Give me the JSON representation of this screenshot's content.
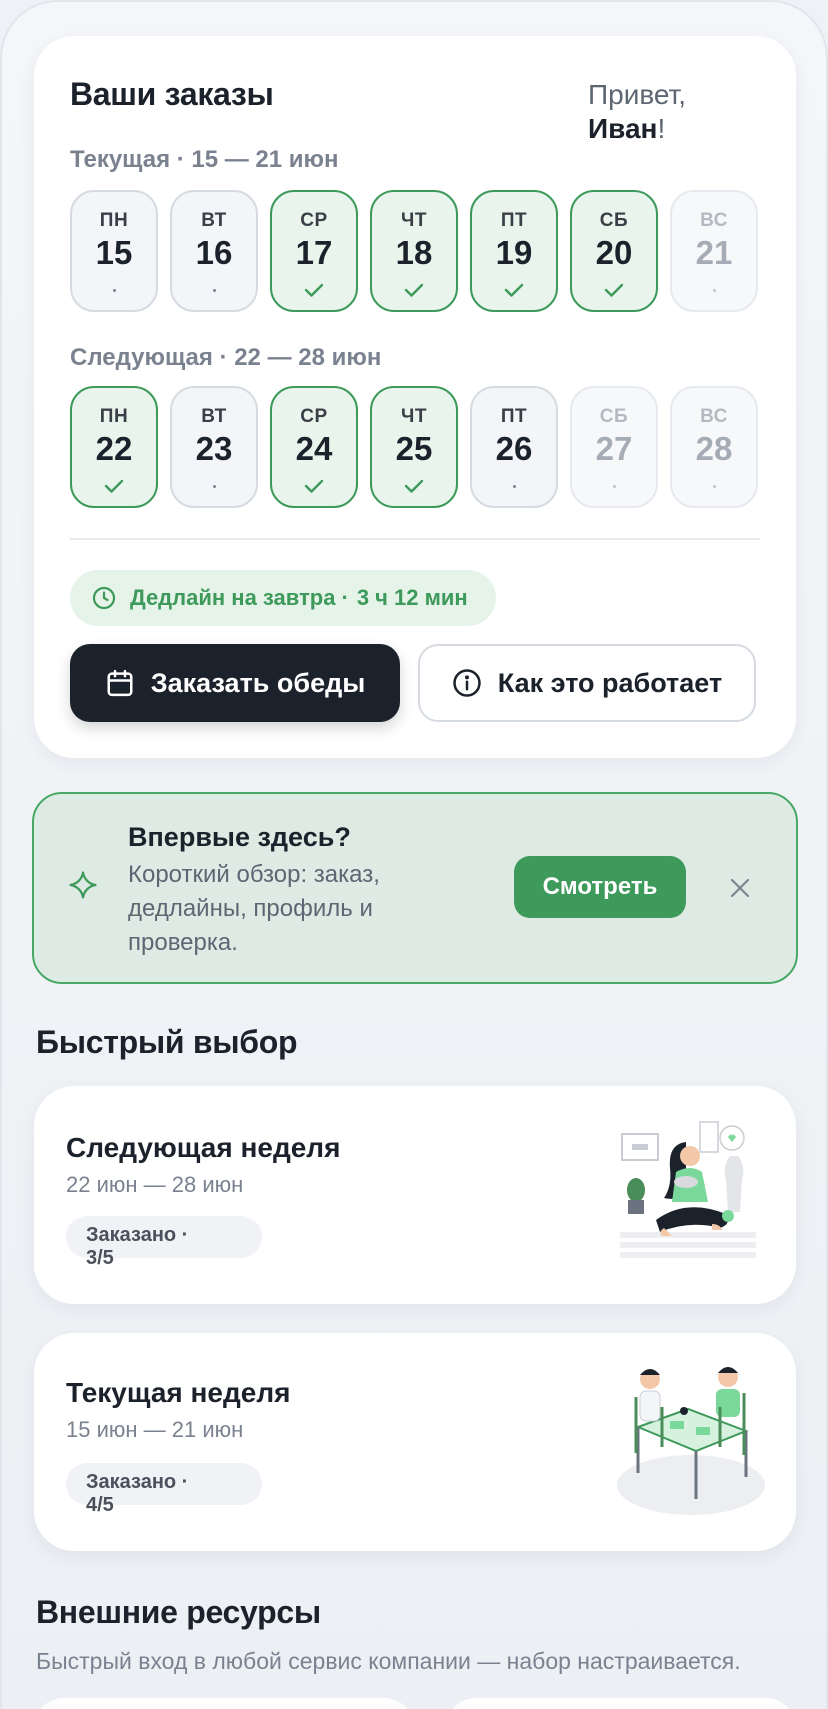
{
  "orders": {
    "title": "Ваши заказы",
    "greeting": "Привет,",
    "user_name": "Иван",
    "greeting_suffix": "!",
    "current_week": {
      "label": "Текущая · 15 — 21 июн",
      "days": [
        {
          "name": "ПН",
          "num": "15",
          "state": "dot"
        },
        {
          "name": "ВТ",
          "num": "16",
          "state": "dot"
        },
        {
          "name": "СР",
          "num": "17",
          "state": "ordered"
        },
        {
          "name": "ЧТ",
          "num": "18",
          "state": "ordered"
        },
        {
          "name": "ПТ",
          "num": "19",
          "state": "ordered"
        },
        {
          "name": "СБ",
          "num": "20",
          "state": "ordered"
        },
        {
          "name": "ВС",
          "num": "21",
          "state": "faded"
        }
      ]
    },
    "next_week": {
      "label": "Следующая · 22 — 28 июн",
      "days": [
        {
          "name": "ПН",
          "num": "22",
          "state": "ordered"
        },
        {
          "name": "ВТ",
          "num": "23",
          "state": "dot"
        },
        {
          "name": "СР",
          "num": "24",
          "state": "ordered"
        },
        {
          "name": "ЧТ",
          "num": "25",
          "state": "ordered"
        },
        {
          "name": "ПТ",
          "num": "26",
          "state": "dot"
        },
        {
          "name": "СБ",
          "num": "27",
          "state": "faded"
        },
        {
          "name": "ВС",
          "num": "28",
          "state": "faded"
        }
      ]
    },
    "deadline_label": "Дедлайн на завтра",
    "deadline_sep": "·",
    "deadline_value": "3 ч 12 мин",
    "order_button": "Заказать обеды",
    "how_button": "Как это работает"
  },
  "onboarding": {
    "title": "Впервые здесь?",
    "text": "Короткий обзор: заказ, дедлайны, профиль и проверка.",
    "button": "Смотреть"
  },
  "quick_pick": {
    "title": "Быстрый выбор",
    "cards": [
      {
        "title": "Следующая неделя",
        "dates": "22 июн — 28 июн",
        "status_label": "Заказано ·",
        "status_value": "3/5"
      },
      {
        "title": "Текущая неделя",
        "dates": "15 июн — 21 июн",
        "status_label": "Заказано ·",
        "status_value": "4/5"
      }
    ]
  },
  "resources": {
    "title": "Внешние ресурсы",
    "subtitle": "Быстрый вход в любой сервис компании — набор настраивается."
  },
  "colors": {
    "accent_green": "#3d9a5a",
    "dark": "#1c222b",
    "banner_bg": "#deebe4"
  }
}
